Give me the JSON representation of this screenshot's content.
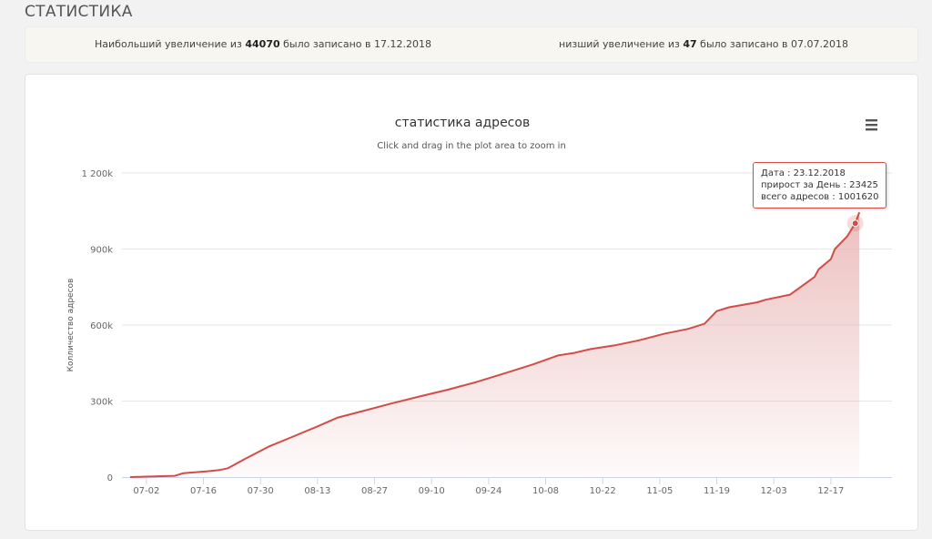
{
  "page": {
    "title": "СТАТИСТИКА"
  },
  "records": {
    "max": {
      "prefix": "Наибольший увеличение из",
      "value": "44070",
      "suffix": "было записано в 17.12.2018"
    },
    "min": {
      "prefix": "низший увеличение из",
      "value": "47",
      "suffix": "было записано в 07.07.2018"
    }
  },
  "menu_icon": "hamburger-menu-icon",
  "colors": {
    "line": "#d24c48",
    "area": "#e8b4b3",
    "marker": "#d24c48"
  },
  "tooltip": {
    "date_label": "Дата",
    "date_value": "23.12.2018",
    "growth_label": "прирост за День",
    "growth_value": "23425",
    "total_label": "всего адресов",
    "total_value": "1001620"
  },
  "chart_data": {
    "type": "area",
    "title": "статистика адресов",
    "subtitle": "Click and drag in the plot area to zoom in",
    "ylabel": "Колличество адресов",
    "xlabel": "",
    "ylim": [
      0,
      1200000
    ],
    "y_ticks": [
      0,
      300000,
      600000,
      900000,
      1200000
    ],
    "y_tick_labels": [
      "0",
      "300k",
      "600k",
      "900k",
      "1 200k"
    ],
    "x_range": [
      "2018-06-26",
      "2019-01-01"
    ],
    "x_ticks": [
      "2018-07-02",
      "2018-07-16",
      "2018-07-30",
      "2018-08-13",
      "2018-08-27",
      "2018-09-10",
      "2018-09-24",
      "2018-10-08",
      "2018-10-22",
      "2018-11-05",
      "2018-11-19",
      "2018-12-03",
      "2018-12-17"
    ],
    "x_tick_labels": [
      "07-02",
      "07-16",
      "07-30",
      "08-13",
      "08-27",
      "09-10",
      "09-24",
      "10-08",
      "10-22",
      "11-05",
      "11-19",
      "12-03",
      "12-17"
    ],
    "grid": true,
    "legend": "none",
    "series": [
      {
        "points": [
          [
            "2018-06-28",
            0
          ],
          [
            "2018-07-03",
            2000
          ],
          [
            "2018-07-09",
            5000
          ],
          [
            "2018-07-11",
            15000
          ],
          [
            "2018-07-17",
            23000
          ],
          [
            "2018-07-20",
            28000
          ],
          [
            "2018-07-22",
            35000
          ],
          [
            "2018-07-26",
            70000
          ],
          [
            "2018-08-01",
            120000
          ],
          [
            "2018-08-07",
            160000
          ],
          [
            "2018-08-13",
            200000
          ],
          [
            "2018-08-18",
            235000
          ],
          [
            "2018-08-24",
            260000
          ],
          [
            "2018-08-31",
            290000
          ],
          [
            "2018-09-07",
            318000
          ],
          [
            "2018-09-14",
            345000
          ],
          [
            "2018-09-21",
            375000
          ],
          [
            "2018-09-28",
            410000
          ],
          [
            "2018-10-05",
            445000
          ],
          [
            "2018-10-11",
            480000
          ],
          [
            "2018-10-15",
            490000
          ],
          [
            "2018-10-19",
            505000
          ],
          [
            "2018-10-25",
            520000
          ],
          [
            "2018-10-31",
            540000
          ],
          [
            "2018-11-06",
            565000
          ],
          [
            "2018-11-12",
            585000
          ],
          [
            "2018-11-16",
            605000
          ],
          [
            "2018-11-19",
            655000
          ],
          [
            "2018-11-22",
            670000
          ],
          [
            "2018-11-29",
            690000
          ],
          [
            "2018-12-01",
            700000
          ],
          [
            "2018-12-07",
            720000
          ],
          [
            "2018-12-13",
            790000
          ],
          [
            "2018-12-14",
            820000
          ],
          [
            "2018-12-17",
            860000
          ],
          [
            "2018-12-18",
            900000
          ],
          [
            "2018-12-21",
            950000
          ],
          [
            "2018-12-23",
            1001620
          ],
          [
            "2018-12-24",
            1045000
          ]
        ]
      }
    ],
    "highlight_point": [
      "2018-12-23",
      1001620
    ]
  }
}
